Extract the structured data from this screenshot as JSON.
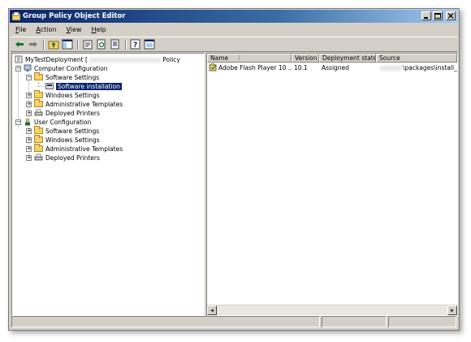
{
  "window": {
    "title": "Group Policy Object Editor"
  },
  "menu": [
    {
      "label": "File",
      "hot": "F",
      "rest": "ile"
    },
    {
      "label": "Action",
      "hot": "A",
      "rest": "ction"
    },
    {
      "label": "View",
      "hot": "V",
      "rest": "iew"
    },
    {
      "label": "Help",
      "hot": "H",
      "rest": "elp"
    }
  ],
  "toolbar": {
    "icons": [
      "back-arrow-icon",
      "forward-arrow-icon",
      "up-folder-icon",
      "show-hide-tree-icon",
      "properties-icon",
      "refresh-icon",
      "export-list-icon",
      "help-icon",
      "console-icon"
    ]
  },
  "tree": {
    "root_label_prefix": "MyTestDeployment [",
    "root_label_suffix": "Policy",
    "computer_config": "Computer Configuration",
    "user_config": "User Configuration",
    "computer_children": [
      "Software Settings",
      "Windows Settings",
      "Administrative Templates",
      "Deployed Printers"
    ],
    "software_installation": "Software installation",
    "user_children": [
      "Software Settings",
      "Windows Settings",
      "Administrative Templates",
      "Deployed Printers"
    ]
  },
  "list": {
    "columns": [
      "Name",
      "Version",
      "Deployment state",
      "Source"
    ],
    "sort_indicator": "/",
    "rows": [
      {
        "name": "Adobe Flash Player 10 ...",
        "version": "10.1",
        "state": "Assigned",
        "source": "\\packages\\install_f"
      }
    ]
  },
  "colors": {
    "title_bar": "#0a246a",
    "window_face": "#d4d0c8",
    "selection": "#0a246a"
  }
}
